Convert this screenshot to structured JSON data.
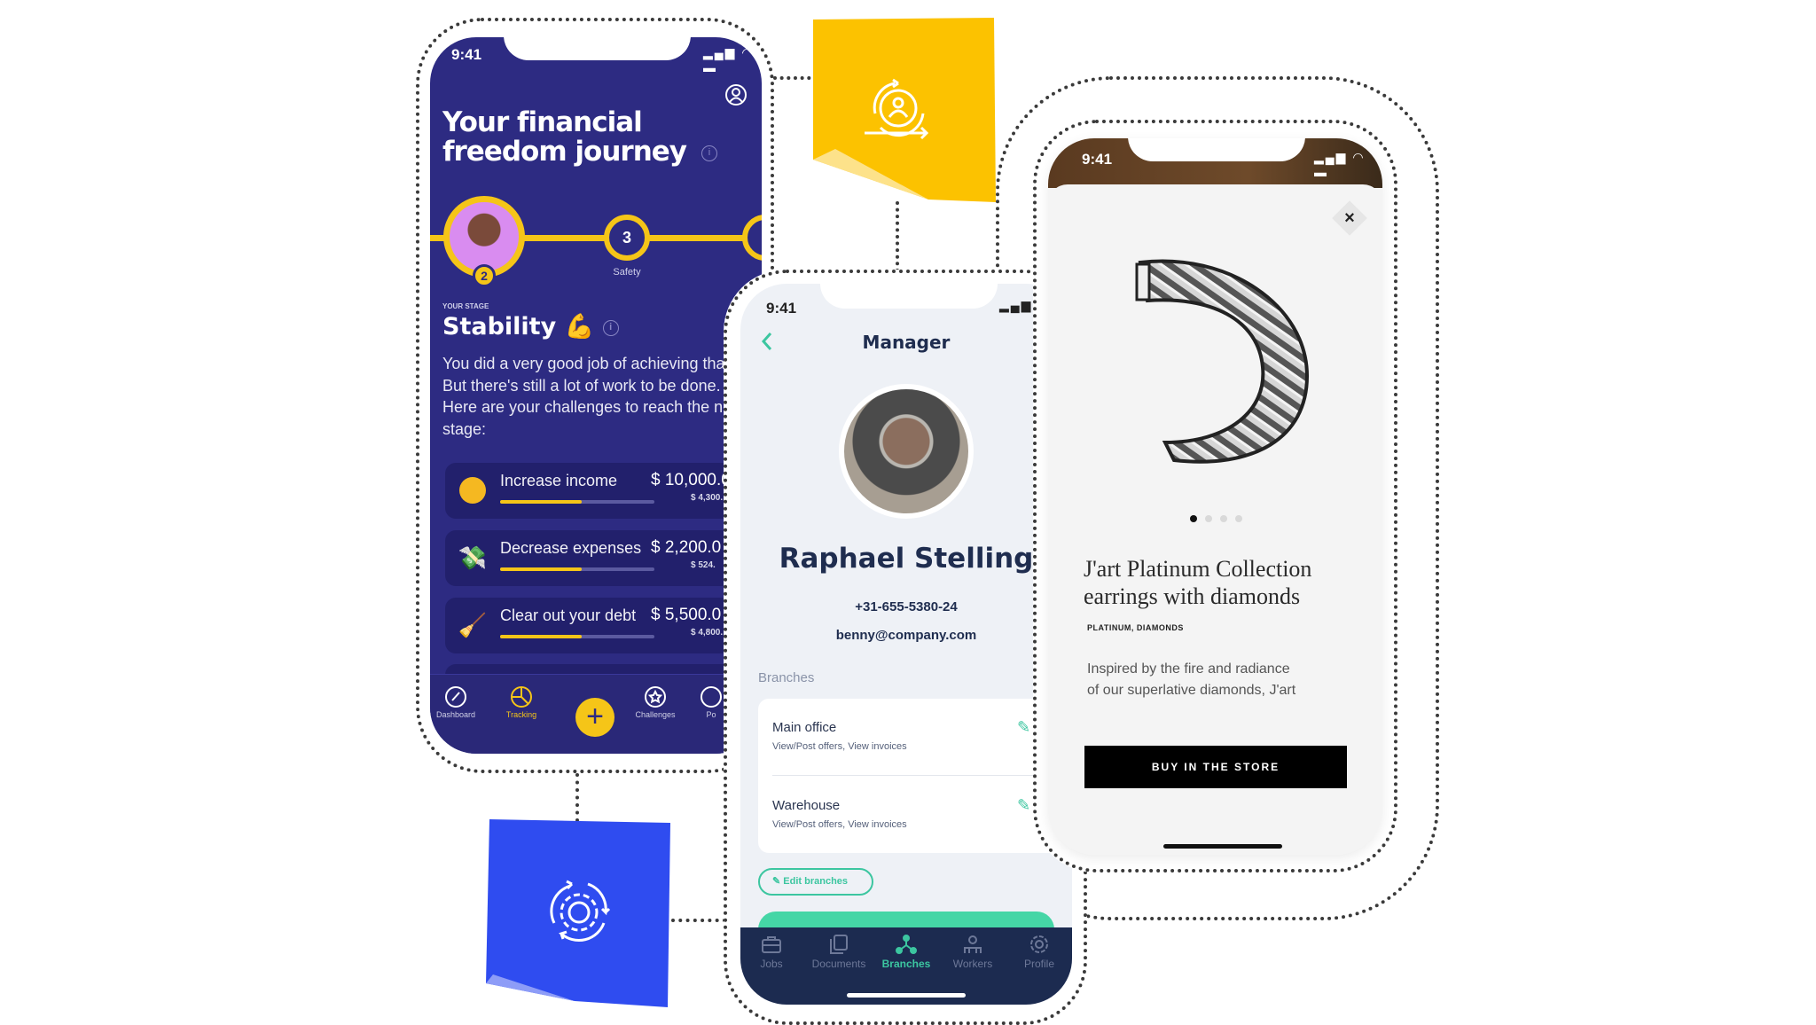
{
  "colors": {
    "navy": "#2d2b82",
    "yellow": "#f5c518",
    "green": "#3cc6a0",
    "blue": "#2f4cf0",
    "sticky_yellow": "#fcc200",
    "dark_nav": "#1c2b50"
  },
  "finance_app": {
    "status_time": "9:41",
    "title": "Your financial freedom journey",
    "current_stage_number": "2",
    "next_stage_number": "3",
    "next_stage_label": "Safety",
    "stage_caption": "YOUR STAGE",
    "stage_name": "Stability",
    "stage_emoji": "💪",
    "description_lines": [
      "You did a very good job of achieving tha",
      "But there's still a lot of work to be done.",
      "Here are your challenges to reach the ne",
      "stage:"
    ],
    "challenges": [
      {
        "label": "Increase income",
        "target": "$ 10,000.0",
        "current": "$ 4,300.",
        "progress": 0.53,
        "icon": "coin-icon"
      },
      {
        "label": "Decrease expenses",
        "target": "$ 2,200.0",
        "current": "$ 524.",
        "progress": 0.53,
        "icon": "money-icon"
      },
      {
        "label": "Clear out your debt",
        "target": "$ 5,500.0",
        "current": "$ 4,800.",
        "progress": 0.53,
        "icon": "broom-icon"
      }
    ],
    "nav": [
      {
        "label": "Dashboard"
      },
      {
        "label": "Tracking",
        "active": true
      },
      {
        "label": "Challenges"
      },
      {
        "label": "Po"
      }
    ]
  },
  "manager_app": {
    "status_time": "9:41",
    "header_title": "Manager",
    "name": "Raphael Stelling",
    "phone": "+31-655-5380-24",
    "email": "benny@company.com",
    "section_label": "Branches",
    "branches": [
      {
        "name": "Main office",
        "permissions": "View/Post offers, View invoices"
      },
      {
        "name": "Warehouse",
        "permissions": "View/Post offers, View invoices"
      }
    ],
    "edit_button": "Edit branches",
    "nav": [
      {
        "label": "Jobs"
      },
      {
        "label": "Documents"
      },
      {
        "label": "Branches",
        "active": true
      },
      {
        "label": "Workers"
      },
      {
        "label": "Profile"
      }
    ]
  },
  "jewelry_app": {
    "status_time": "9:41",
    "carousel_pages": 4,
    "carousel_active": 1,
    "title_lines": [
      "J'art Platinum Collection",
      "earrings with diamonds"
    ],
    "tags": "PLATINUM, DIAMONDS",
    "description_lines": [
      "Inspired by the fire and radiance",
      "of our superlative diamonds, J'art"
    ],
    "buy_button": "BUY IN THE STORE"
  }
}
